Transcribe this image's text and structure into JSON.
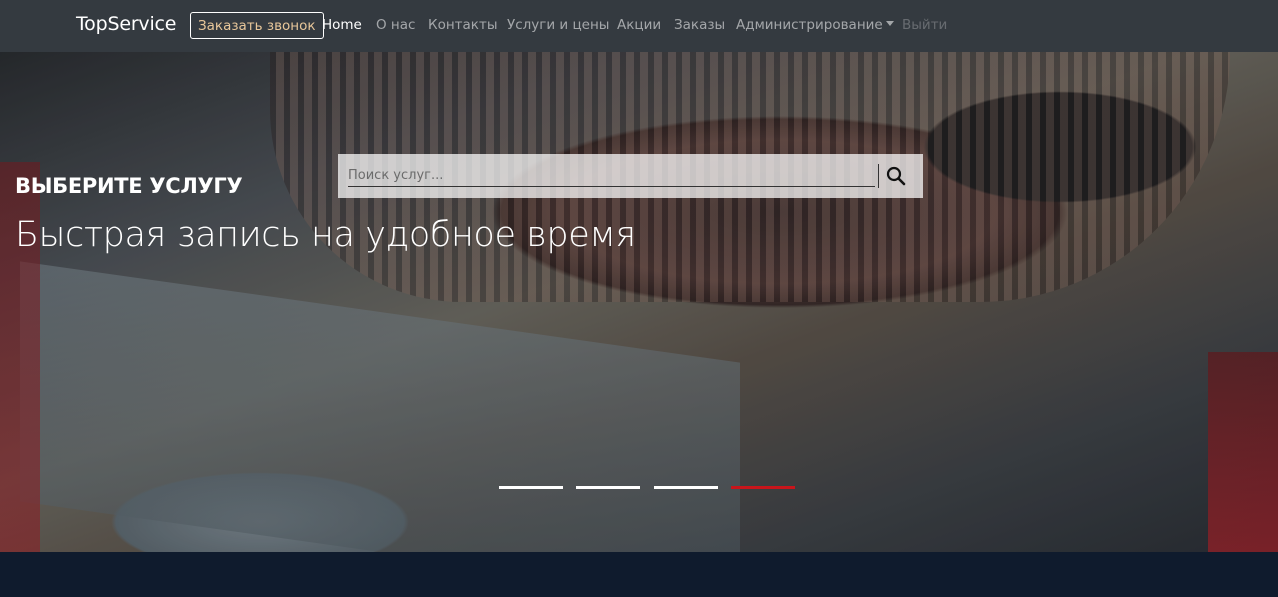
{
  "navbar": {
    "brand": "TopService",
    "call_button": "Заказать звонок",
    "links": [
      {
        "label": "Home"
      },
      {
        "label": "О нас"
      },
      {
        "label": "Контакты"
      },
      {
        "label": "Услуги и цены"
      },
      {
        "label": "Акции"
      },
      {
        "label": "Заказы"
      },
      {
        "label": "Администрирование"
      },
      {
        "label": "Выйти"
      }
    ]
  },
  "search": {
    "placeholder": "Поиск услуг...",
    "icon": "search-icon"
  },
  "hero": {
    "subtitle": "ВЫБЕРИТЕ УСЛУГУ",
    "title": "Быстрая запись на удобное время",
    "slides_count": 4,
    "active_slide": 4
  },
  "colors": {
    "navbar_bg": "#343a40",
    "indicator_active": "#c8151b",
    "footer_bg": "#0f1b2d"
  }
}
